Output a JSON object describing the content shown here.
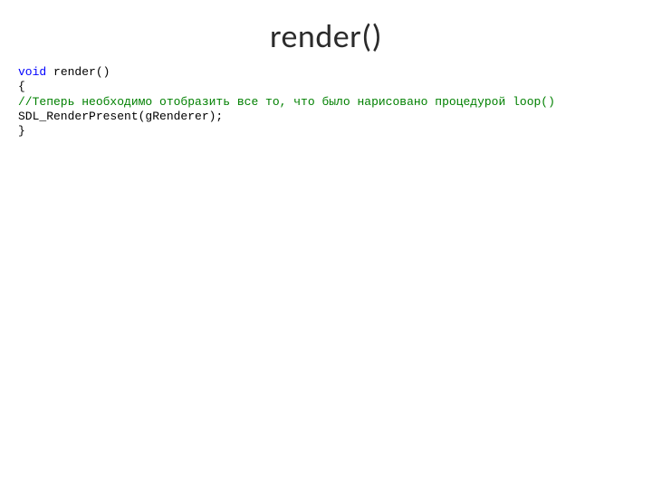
{
  "title": "render()",
  "code": {
    "l1_kw": "void",
    "l1_rest": " render()",
    "l2": "{",
    "l3_comment": "//Теперь необходимо отобразить все то, что было нарисовано процедурой loop()",
    "l4": "SDL_RenderPresent(gRenderer);",
    "l5": "}"
  }
}
